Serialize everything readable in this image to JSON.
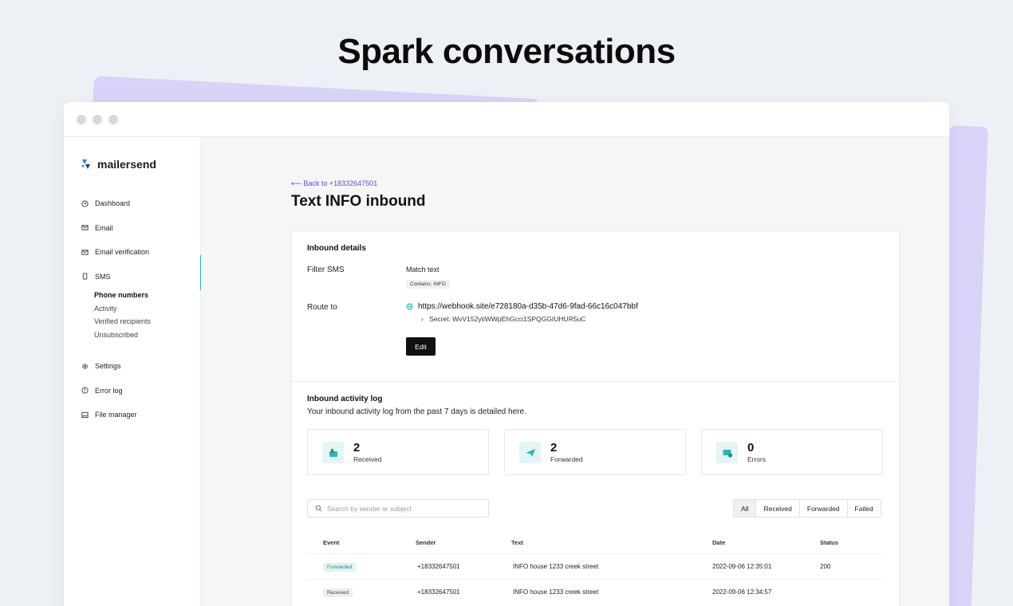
{
  "headline": "Spark conversations",
  "sidebar": {
    "logo": "mailersend",
    "items": [
      {
        "label": "Dashboard",
        "icon": "clock-icon"
      },
      {
        "label": "Email",
        "icon": "mail-icon"
      },
      {
        "label": "Email verification",
        "icon": "mail-check-icon"
      },
      {
        "label": "SMS",
        "icon": "phone-icon"
      }
    ],
    "sms_sub": [
      "Phone numbers",
      "Activity",
      "Verified recipients",
      "Unsubscribed"
    ],
    "bottom_items": [
      {
        "label": "Settings",
        "icon": "gear-icon"
      },
      {
        "label": "Error log",
        "icon": "alert-icon"
      },
      {
        "label": "File manager",
        "icon": "image-icon"
      }
    ]
  },
  "main": {
    "back_link": "⟵ Back to +18332647501",
    "title": "Text INFO inbound",
    "details": {
      "title": "Inbound details",
      "filter_label": "Filter SMS",
      "filter_value": "Match text",
      "filter_pill": "Contains: INFO",
      "route_label": "Route to",
      "route_url": "https://webhook.site/e728180a-d35b-47d6-9fad-66c16c047bbf",
      "secret": "Secret: WvV152ytiWWpEhGcci1SPQGGIUHUR5uC",
      "edit_label": "Edit"
    },
    "log": {
      "title": "Inbound activity log",
      "description": "Your inbound activity log from the past 7 days is detailed here.",
      "stats": [
        {
          "value": "2",
          "label": "Received",
          "icon": "inbox-icon"
        },
        {
          "value": "2",
          "label": "Forwarded",
          "icon": "send-icon"
        },
        {
          "value": "0",
          "label": "Errors",
          "icon": "error-mail-icon"
        }
      ],
      "search_placeholder": "Search by sender or subject",
      "filters": [
        "All",
        "Received",
        "Forwarded",
        "Failed"
      ],
      "columns": [
        "Event",
        "Sender",
        "Text",
        "Date",
        "Status"
      ],
      "rows": [
        {
          "event": "Forwarded",
          "sender": "+18332647501",
          "text": "INFO house 1233 creek street",
          "date": "2022-09-06 12:35:01",
          "status": "200"
        },
        {
          "event": "Received",
          "sender": "+18332647501",
          "text": "INFO house 1233 creek street",
          "date": "2022-09-06 12:34:57",
          "status": ""
        }
      ]
    }
  },
  "colors": {
    "accent": "#2bb6ad",
    "link": "#5a4fcf",
    "deco": "#d8d4f7"
  }
}
